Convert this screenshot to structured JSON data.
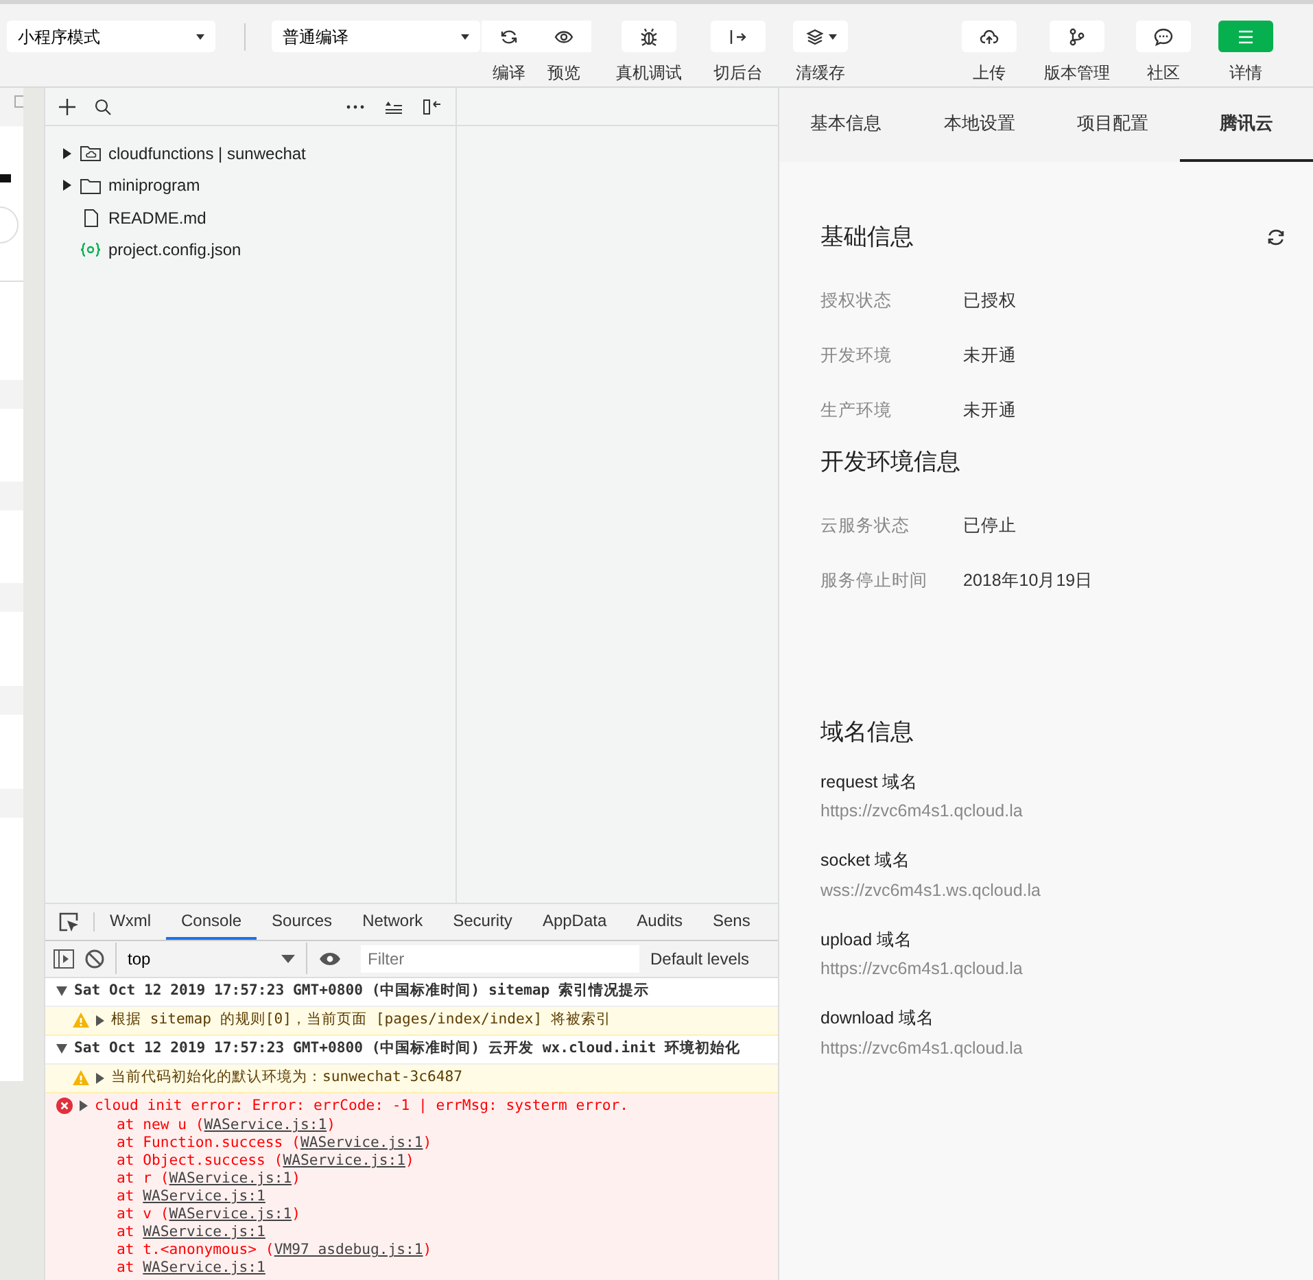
{
  "toolbar": {
    "mode_select": "小程序模式",
    "compile_select": "普通编译",
    "buttons": [
      {
        "label": "编译",
        "active": false
      },
      {
        "label": "预览",
        "active": false
      },
      {
        "label": "真机调试",
        "active": false
      },
      {
        "label": "切后台",
        "active": false
      },
      {
        "label": "清缓存",
        "active": false
      },
      {
        "label": "上传",
        "active": false
      },
      {
        "label": "版本管理",
        "active": false
      },
      {
        "label": "社区",
        "active": false
      },
      {
        "label": "详情",
        "active": true
      }
    ]
  },
  "file_tree": [
    {
      "name": "cloudfunctions | sunwechat",
      "kind": "cloud-folder",
      "expanded": false
    },
    {
      "name": "miniprogram",
      "kind": "folder",
      "expanded": false
    },
    {
      "name": "README.md",
      "kind": "file"
    },
    {
      "name": "project.config.json",
      "kind": "json"
    }
  ],
  "devtools": {
    "tabs": [
      {
        "label": "Wxml",
        "selected": false
      },
      {
        "label": "Console",
        "selected": true
      },
      {
        "label": "Sources",
        "selected": false
      },
      {
        "label": "Network",
        "selected": false
      },
      {
        "label": "Security",
        "selected": false
      },
      {
        "label": "AppData",
        "selected": false
      },
      {
        "label": "Audits",
        "selected": false
      },
      {
        "label": "Sens",
        "selected": false
      }
    ],
    "context": "top",
    "filter_placeholder": "Filter",
    "levels": "Default levels",
    "console": [
      {
        "kind": "group",
        "text": "Sat Oct 12 2019 17:57:23 GMT+0800 (中国标准时间) sitemap 索引情况提示"
      },
      {
        "kind": "warning",
        "text": "根据 sitemap 的规则[0]，当前页面 [pages/index/index] 将被索引"
      },
      {
        "kind": "group",
        "text": "Sat Oct 12 2019 17:57:23 GMT+0800 (中国标准时间) 云开发 wx.cloud.init 环境初始化"
      },
      {
        "kind": "warning",
        "text": "当前代码初始化的默认环境为：sunwechat-3c6487"
      },
      {
        "kind": "error",
        "text": "cloud init error:  Error: errCode: -1  | errMsg: systerm error.",
        "stack": [
          {
            "prefix": "at new u (",
            "link": "WAService.js:1",
            "suffix": ")"
          },
          {
            "prefix": "at Function.success (",
            "link": "WAService.js:1",
            "suffix": ")"
          },
          {
            "prefix": "at Object.success (",
            "link": "WAService.js:1",
            "suffix": ")"
          },
          {
            "prefix": "at r (",
            "link": "WAService.js:1",
            "suffix": ")"
          },
          {
            "prefix": "at ",
            "link": "WAService.js:1"
          },
          {
            "prefix": "at v (",
            "link": "WAService.js:1",
            "suffix": ")"
          },
          {
            "prefix": "at ",
            "link": "WAService.js:1"
          },
          {
            "prefix": "at t.<anonymous> (",
            "link": "VM97 asdebug.js:1",
            "suffix": ")"
          },
          {
            "prefix": "at ",
            "link": "WAService.js:1"
          }
        ]
      }
    ]
  },
  "details": {
    "tabs": [
      {
        "label": "基本信息",
        "selected": false
      },
      {
        "label": "本地设置",
        "selected": false
      },
      {
        "label": "项目配置",
        "selected": false
      },
      {
        "label": "腾讯云",
        "selected": true
      }
    ],
    "sections": [
      {
        "title": "基础信息",
        "refresh": true,
        "rows": [
          {
            "label": "授权状态",
            "value": "已授权"
          },
          {
            "label": "开发环境",
            "value": "未开通"
          },
          {
            "label": "生产环境",
            "value": "未开通"
          }
        ]
      },
      {
        "title": "开发环境信息",
        "refresh": false,
        "rows": [
          {
            "label": "云服务状态",
            "value": "已停止"
          },
          {
            "label": "服务停止时间",
            "value": "2018年10月19日"
          }
        ]
      }
    ],
    "domains_title": "域名信息",
    "domains": [
      {
        "title": "request 域名",
        "value": "https://zvc6m4s1.qcloud.la"
      },
      {
        "title": "socket 域名",
        "value": "wss://zvc6m4s1.ws.qcloud.la"
      },
      {
        "title": "upload 域名",
        "value": "https://zvc6m4s1.qcloud.la"
      },
      {
        "title": "download 域名",
        "value": "https://zvc6m4s1.qcloud.la"
      }
    ]
  }
}
